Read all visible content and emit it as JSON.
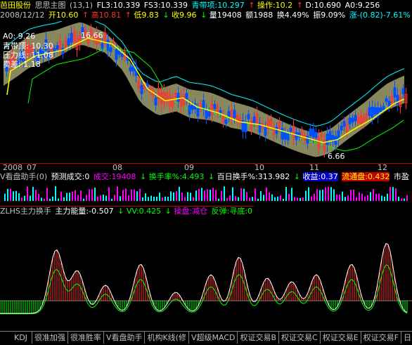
{
  "header": {
    "stock_name": "芭田股份",
    "indicator": "思思主图",
    "params": "(13,1)",
    "fl3": "FL3:10.339",
    "fs3": "FS3:10.339",
    "qdd": "青带项:10.297",
    "op": "操作:10.2",
    "d": "D:10.690",
    "a0": "A0:9.256"
  },
  "quote": {
    "date": "2008/12/12",
    "open": "开10.60",
    "high": "高10.81",
    "low": "低9.83",
    "close": "收9.96",
    "volume": "量19408",
    "amount": "额1988",
    "turnover": "换4.49%",
    "amplitude": "振9.09%",
    "change": "涨-(0.82)-7.61%",
    "arrow_up": "↑",
    "arrow_down": "↓"
  },
  "main_labels": {
    "a0": "A0: 9.26",
    "qdd": "青带顶: 10.30",
    "ylx": "压力线: 11.08",
    "maic": "卖差: 1.18",
    "high_mark": "16.66",
    "low_mark": "6.66"
  },
  "date_axis": {
    "year": "2008",
    "months": [
      "07",
      "08",
      "09",
      "10",
      "11",
      "12"
    ]
  },
  "vol_panel": {
    "title": "V看盘助手(0)",
    "pred": "预测成交:0",
    "cj": "成交:19408",
    "hsl": "换手率%:4.493",
    "bh": "百日换手%:313.982",
    "sy": "收益:0.37",
    "lt": "流通盘:0.432",
    "sy2": "市盈"
  },
  "zl_panel": {
    "title": "ZLHS主力换手",
    "zl": "主力能量:-0.507",
    "vv": "VV:0.425",
    "cp": "操盘:减仓",
    "fb": "反弹:寻底:0"
  },
  "tabs": [
    "KDJ",
    "很准加强",
    "很准胜率",
    "V看盘助手",
    "机构K线(修",
    "V超级MACD",
    "权证交易B",
    "权证交易C",
    "权证交易E",
    "权证交易F",
    "日分隔"
  ],
  "chart_data": {
    "type": "candlestick",
    "price_markers": {
      "high": 16.66,
      "low": 6.66
    },
    "months": [
      "07",
      "08",
      "09",
      "10",
      "11",
      "12"
    ],
    "last_close": 9.96,
    "colors": {
      "up": "#ff3030",
      "down": "#0050ff",
      "ma": "#ffff00",
      "band_fill": "#a0a070"
    }
  }
}
